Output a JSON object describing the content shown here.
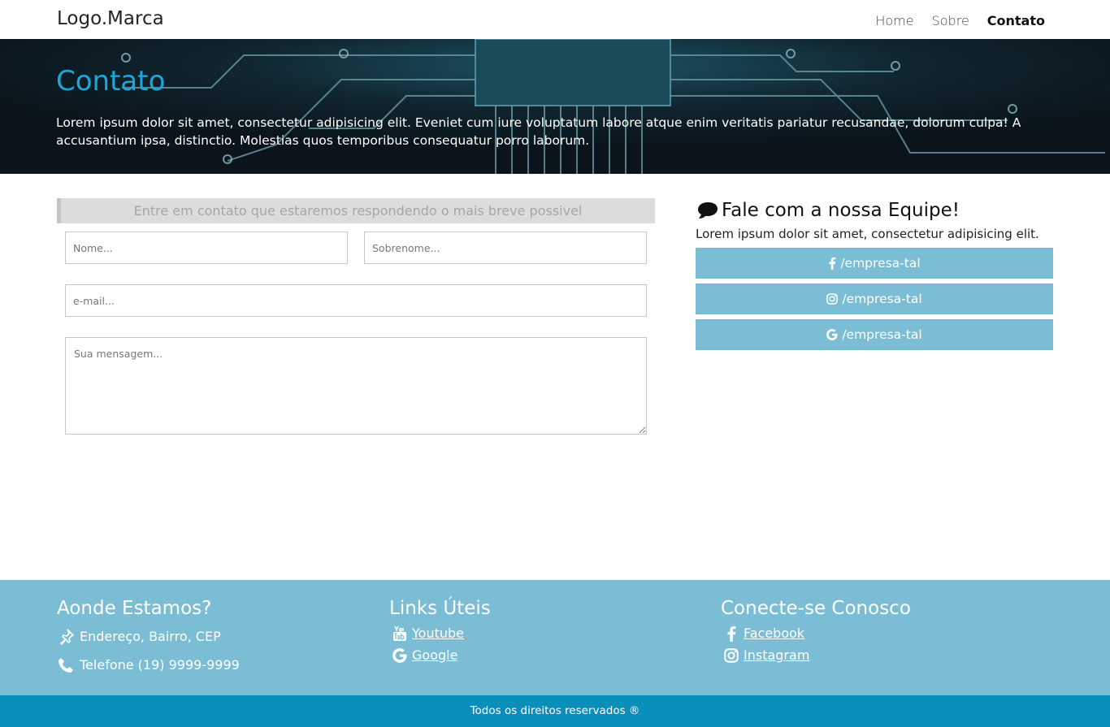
{
  "navbar": {
    "brand": "Logo.Marca",
    "links": [
      {
        "label": "Home",
        "active": false
      },
      {
        "label": "Sobre",
        "active": false
      },
      {
        "label": "Contato",
        "active": true
      }
    ]
  },
  "hero": {
    "title": "Contato",
    "text": "Lorem ipsum dolor sit amet, consectetur adipisicing elit. Eveniet cum iure voluptatum labore atque enim veritatis pariatur recusandae, dolorum culpa! A accusantium ipsa, distinctio. Molestias quos temporibus consequatur porro laborum."
  },
  "form": {
    "heading": "Entre em contato que estaremos respondendo o mais breve possivel",
    "fields": {
      "nome": {
        "placeholder": "Nome...",
        "value": ""
      },
      "sobrenome": {
        "placeholder": "Sobrenome...",
        "value": ""
      },
      "email": {
        "placeholder": "e-mail...",
        "value": ""
      },
      "mensagem": {
        "placeholder": "Sua mensagem...",
        "value": ""
      }
    }
  },
  "team": {
    "icon": "comment-icon",
    "title": "Fale com a nossa Equipe!",
    "text": "Lorem ipsum dolor sit amet, consectetur adipisicing elit.",
    "buttons": [
      {
        "icon": "facebook-icon",
        "label": "/empresa-tal"
      },
      {
        "icon": "instagram-icon",
        "label": "/empresa-tal"
      },
      {
        "icon": "google-icon",
        "label": "/empresa-tal"
      }
    ]
  },
  "footer": {
    "location": {
      "title": "Aonde Estamos?",
      "items": [
        {
          "icon": "pin-icon",
          "text": "Endereço, Bairro, CEP"
        },
        {
          "icon": "phone-icon",
          "text": "Telefone (19) 9999-9999"
        }
      ]
    },
    "links": {
      "title": "Links Úteis",
      "items": [
        {
          "icon": "youtube-icon",
          "text": "Youtube"
        },
        {
          "icon": "google-icon",
          "text": "Google"
        }
      ]
    },
    "connect": {
      "title": "Conecte-se Conosco",
      "items": [
        {
          "icon": "facebook-icon",
          "text": "Facebook"
        },
        {
          "icon": "instagram-icon",
          "text": "Instagram"
        }
      ]
    },
    "copyright": "Todos os direitos reservados ®"
  },
  "colors": {
    "accent": "#1fa6d9",
    "footer_bg": "#7abdd4",
    "copyright_bg": "#0a8fbd",
    "social_button": "#7abdd4"
  }
}
